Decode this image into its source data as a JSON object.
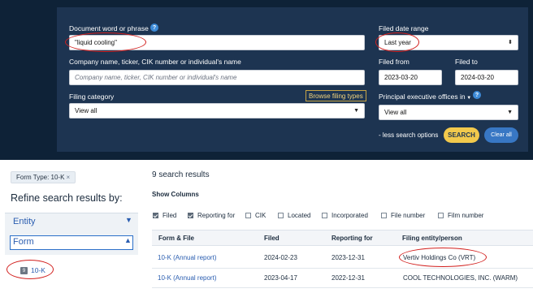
{
  "search": {
    "doc_label": "Document word or phrase",
    "doc_value": "\"liquid cooling\"",
    "company_label": "Company name, ticker, CIK number or individual's name",
    "company_placeholder": "Company name, ticker, CIK number or individual's name",
    "filing_category_label": "Filing category",
    "filing_category_value": "View all",
    "browse_filing_types": "Browse filing types",
    "date_range_label": "Filed date range",
    "date_range_value": "Last year",
    "filed_from_label": "Filed from",
    "filed_from_value": "2023-03-20",
    "filed_to_label": "Filed to",
    "filed_to_value": "2024-03-20",
    "principal_label": "Principal executive offices in",
    "principal_value": "View all",
    "less_options": "- less search options",
    "search_button": "SEARCH",
    "clear_button": "Clear all"
  },
  "filters": {
    "form_type_chip": "Form Type: 10-K",
    "chip_remove": "×"
  },
  "refine": {
    "title": "Refine search results by:",
    "entity": "Entity",
    "form": "Form",
    "form_item_count": "9",
    "form_item_label": "10-K"
  },
  "results": {
    "count_text": "9 search results",
    "show_columns": "Show Columns",
    "columns": [
      "Filed",
      "Reporting for",
      "CIK",
      "Located",
      "Incorporated",
      "File number",
      "Film number"
    ],
    "columns_checked": [
      true,
      true,
      false,
      false,
      false,
      false,
      false
    ],
    "headers": [
      "Form & File",
      "Filed",
      "Reporting for",
      "Filing entity/person"
    ],
    "rows": [
      [
        "10-K (Annual report)",
        "2024-02-23",
        "2023-12-31",
        "Vertiv Holdings Co (VRT)"
      ],
      [
        "10-K (Annual report)",
        "2023-04-17",
        "2022-12-31",
        "COOL TECHNOLOGIES, INC. (WARM)"
      ]
    ]
  },
  "colors": {
    "page_bg": "#0e2237",
    "panel_bg": "#1d3451",
    "search_button": "#f2c94c",
    "clear_button": "#3877c4",
    "link": "#2a5db0",
    "annotation": "#d2201e"
  }
}
